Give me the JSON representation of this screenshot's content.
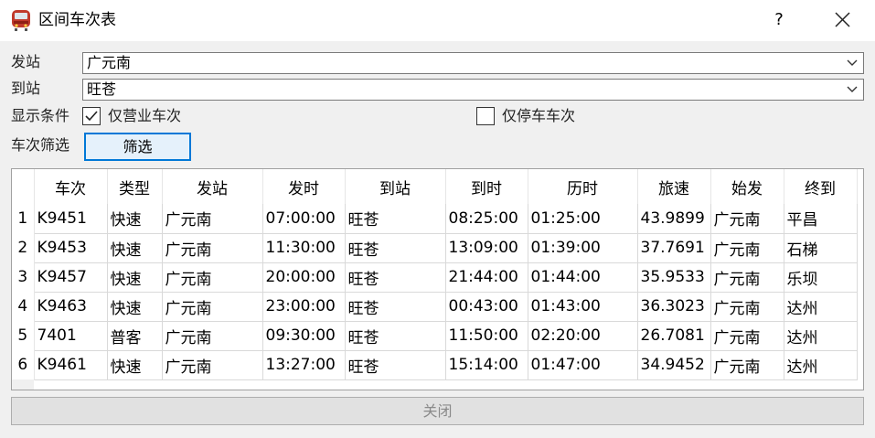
{
  "window": {
    "title": "区间车次表",
    "help": "?"
  },
  "form": {
    "from_label": "发站",
    "from_value": "广元南",
    "to_label": "到站",
    "to_value": "旺苍",
    "display_label": "显示条件",
    "opt_business": {
      "label": "仅营业车次",
      "checked": true
    },
    "opt_stop": {
      "label": "仅停车车次",
      "checked": false
    },
    "filter_label": "车次筛选",
    "filter_button": "筛选"
  },
  "table": {
    "headers": [
      "车次",
      "类型",
      "发站",
      "发时",
      "到站",
      "到时",
      "历时",
      "旅速",
      "始发",
      "终到"
    ],
    "rows": [
      {
        "n": "1",
        "cells": [
          "K9451",
          "快速",
          "广元南",
          "07:00:00",
          "旺苍",
          "08:25:00",
          "01:25:00",
          "43.9899",
          "广元南",
          "平昌"
        ]
      },
      {
        "n": "2",
        "cells": [
          "K9453",
          "快速",
          "广元南",
          "11:30:00",
          "旺苍",
          "13:09:00",
          "01:39:00",
          "37.7691",
          "广元南",
          "石梯"
        ]
      },
      {
        "n": "3",
        "cells": [
          "K9457",
          "快速",
          "广元南",
          "20:00:00",
          "旺苍",
          "21:44:00",
          "01:44:00",
          "35.9533",
          "广元南",
          "乐坝"
        ]
      },
      {
        "n": "4",
        "cells": [
          "K9463",
          "快速",
          "广元南",
          "23:00:00",
          "旺苍",
          "00:43:00",
          "01:43:00",
          "36.3023",
          "广元南",
          "达州"
        ]
      },
      {
        "n": "5",
        "cells": [
          "7401",
          "普客",
          "广元南",
          "09:30:00",
          "旺苍",
          "11:50:00",
          "02:20:00",
          "26.7081",
          "广元南",
          "达州"
        ]
      },
      {
        "n": "6",
        "cells": [
          "K9461",
          "快速",
          "广元南",
          "13:27:00",
          "旺苍",
          "15:14:00",
          "01:47:00",
          "34.9452",
          "广元南",
          "达州"
        ]
      }
    ]
  },
  "footer": {
    "close_button": "关闭"
  }
}
